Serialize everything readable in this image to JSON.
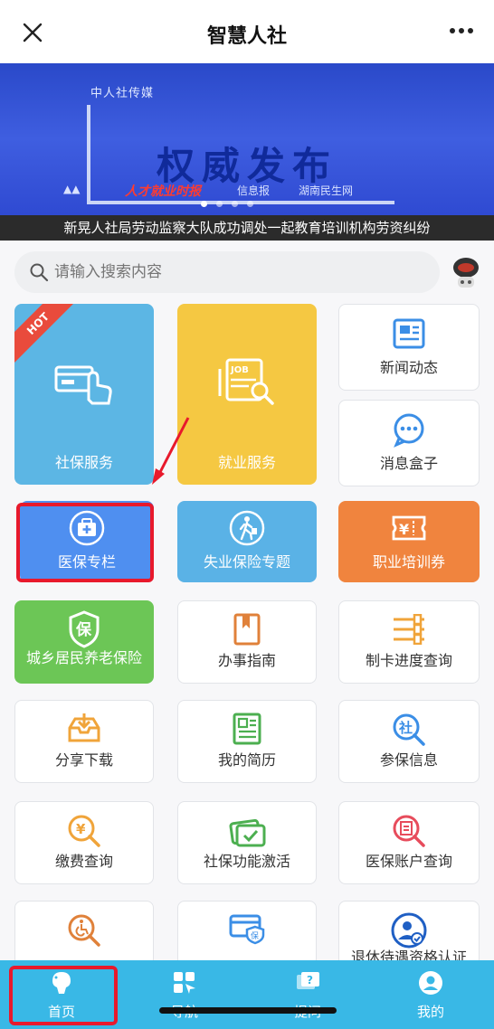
{
  "header": {
    "title": "智慧人社",
    "close_icon": "close-icon",
    "more_icon": "more-icon"
  },
  "banner": {
    "brand": "中人社传媒",
    "headline": "权威发布",
    "partner1": "人才就业时报",
    "partner2": "信息报",
    "partner3": "湖南民生网",
    "slide_count": 4,
    "active_slide": 1
  },
  "ticker": "新晃人社局劳动监察大队成功调处一起教育培训机构劳资纠纷",
  "search": {
    "placeholder": "请输入搜索内容"
  },
  "tiles": {
    "social": {
      "label": "社保服务",
      "badge": "HOT",
      "color": "#5cb6e4"
    },
    "jobs": {
      "label": "就业服务",
      "color": "#f5c842"
    },
    "news": {
      "label": "新闻动态"
    },
    "msg": {
      "label": "消息盒子"
    },
    "medical": {
      "label": "医保专栏",
      "color": "#4f8ff0"
    },
    "unemploy": {
      "label": "失业保险专题",
      "color": "#5ab2e6"
    },
    "training": {
      "label": "职业培训券",
      "color": "#f0843e"
    },
    "pension": {
      "label": "城乡居民养老保险",
      "color": "#6cc656"
    },
    "guide": {
      "label": "办事指南"
    },
    "card": {
      "label": "制卡进度查询"
    },
    "share": {
      "label": "分享下载"
    },
    "resume": {
      "label": "我的简历"
    },
    "insured": {
      "label": "参保信息"
    },
    "payment": {
      "label": "缴费查询"
    },
    "activate": {
      "label": "社保功能激活"
    },
    "medacct": {
      "label": "医保账户查询"
    },
    "retire": {
      "label": "退休待遇资格认证"
    }
  },
  "nav": [
    {
      "label": "首页",
      "icon": "home-icon"
    },
    {
      "label": "导航",
      "icon": "navigation-icon"
    },
    {
      "label": "提问",
      "icon": "question-icon"
    },
    {
      "label": "我的",
      "icon": "profile-icon"
    }
  ]
}
